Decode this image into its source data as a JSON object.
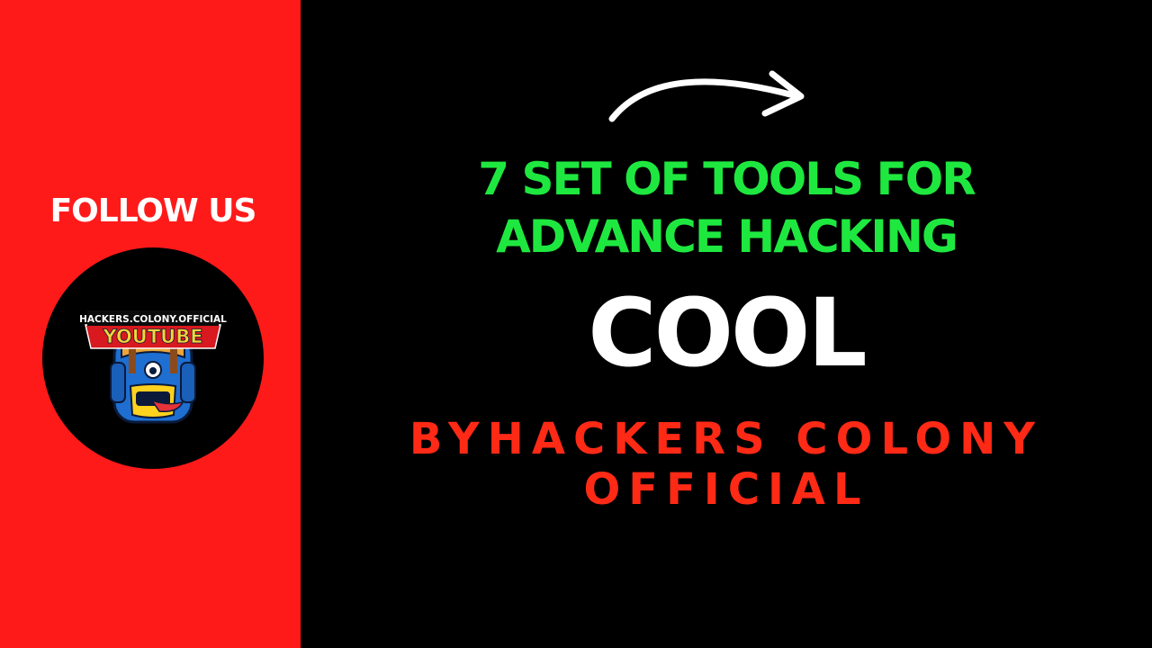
{
  "sidebar": {
    "follow_label": "FOLLOW US",
    "logo": {
      "top_text": "HACKERS.COLONY.OFFICIAL",
      "banner_text": "YOUTUBE",
      "icon": "backpack-mascot-icon"
    }
  },
  "main": {
    "arrow_icon": "curved-arrow-right-icon",
    "headline_line1": "7 SET OF TOOLS FOR",
    "headline_line2": "ADVANCE HACKING",
    "feature_word": "COOL",
    "byline_line1": "BYHACKERS COLONY",
    "byline_line2": "OFFICIAL"
  },
  "colors": {
    "sidebar_background": "#ff1a1a",
    "page_background": "#000000",
    "headline": "#1ee83f",
    "feature_word": "#ffffff",
    "byline": "#ff2a16"
  }
}
